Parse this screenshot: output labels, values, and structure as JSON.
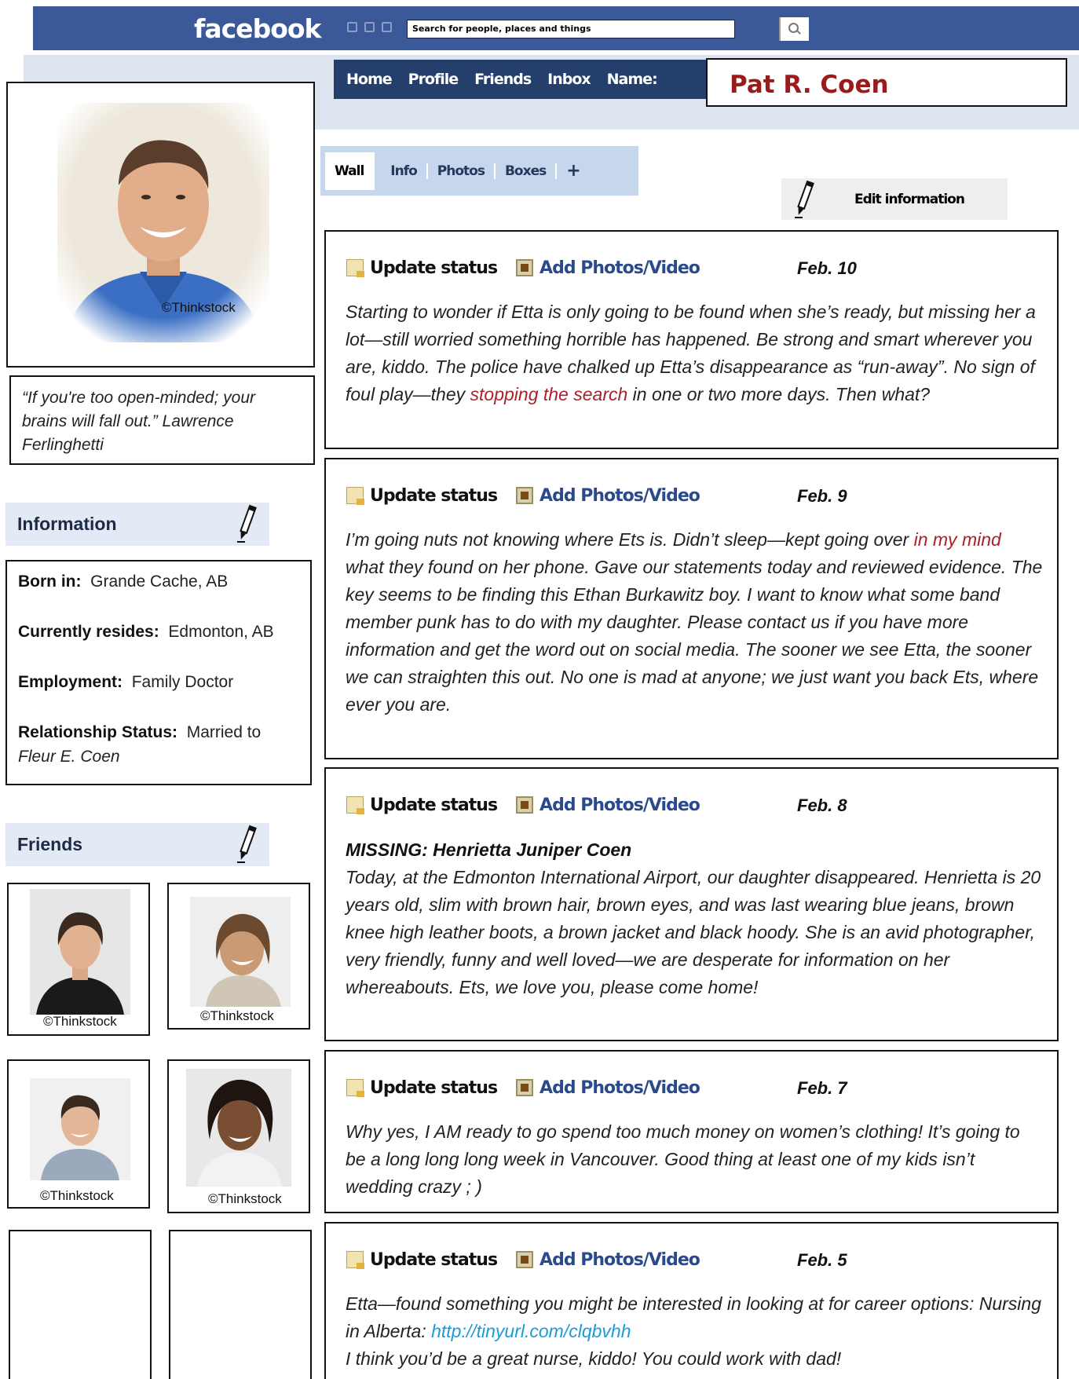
{
  "header": {
    "logo": "facebook",
    "search_placeholder": "Search for people, places and things",
    "nav": [
      "Home",
      "Profile",
      "Friends",
      "Inbox",
      "Name:"
    ],
    "profile_name": "Pat R. Coen"
  },
  "tabs": [
    "Wall",
    "Info",
    "Photos",
    "Boxes",
    "+"
  ],
  "edit_information_label": "Edit information",
  "profile": {
    "photo_credit": "©Thinkstock",
    "quote": "“If you're too open-minded; your brains will fall out.”  Lawrence Ferlinghetti"
  },
  "information": {
    "heading": "Information",
    "born_label": "Born in:",
    "born_value": "Grande Cache, AB",
    "resides_label": "Currently resides:",
    "resides_value": "Edmonton, AB",
    "employment_label": "Employment:",
    "employment_value": "Family Doctor",
    "relationship_label": "Relationship Status:",
    "relationship_value": "Married to",
    "relationship_partner": "Fleur E. Coen"
  },
  "friends": {
    "heading": "Friends",
    "credits": [
      "©Thinkstock",
      "©Thinkstock",
      "©Thinkstock",
      "©Thinkstock"
    ]
  },
  "post_actions": {
    "update_status": "Update status",
    "add_photos": "Add Photos/Video"
  },
  "posts": [
    {
      "date": "Feb. 10",
      "text_a": "Starting to wonder if Etta is only going to be found when she’s ready, but missing her a lot—still worried something horrible has happened.  Be strong and smart wherever you are, kiddo.  The police have chalked up Etta’s disappearance as “run-away”.  No sign of foul play—they ",
      "highlight": "stopping the search",
      "text_b": " in one or two more days.  Then what?"
    },
    {
      "date": "Feb. 9",
      "text_a": "I’m going nuts not knowing where Ets is.  Didn’t sleep—kept going over ",
      "highlight": "in my mind",
      "text_b": " what they found on her phone.  Gave our statements today and reviewed evidence.  The key seems to be finding this Ethan Burkawitz boy.  I want to know what some band member punk has to do with my daughter.  Please contact us if you have more information and get the word out on social media.  The sooner we see Etta, the sooner we can straighten this out.  No one is mad at anyone; we just want you back Ets, where ever you are."
    },
    {
      "date": "Feb. 8",
      "title": "MISSING: Henrietta Juniper Coen",
      "text": "Today, at the Edmonton International Airport, our daughter disappeared.  Henrietta is 20 years old, slim with brown hair, brown eyes, and was last wearing blue jeans, brown knee high leather boots, a brown jacket and black hoody.  She is an avid photographer, very friendly, funny and well loved—we are desperate for information on her whereabouts.  Ets, we love you, please come home!"
    },
    {
      "date": "Feb. 7",
      "text": "Why yes, I AM ready to go spend too much money on women’s clothing!  It’s going to be a long long long week in Vancouver.  Good thing at least one of my kids isn’t wedding crazy ; )"
    },
    {
      "date": "Feb. 5",
      "text_a": "Etta—found something you might be interested in looking at for career options:  Nursing in Alberta:  ",
      "link": "http://tinyurl.com/clqbvhh",
      "text_b": "I think you’d be a great nurse, kiddo!  You could work with dad!"
    }
  ],
  "colors": {
    "facebook_blue": "#3b5998",
    "nav_dark": "#243f6b",
    "name_red": "#9b1b1b",
    "highlight_red": "#a8222a",
    "link_blue": "#1e9ad6"
  }
}
